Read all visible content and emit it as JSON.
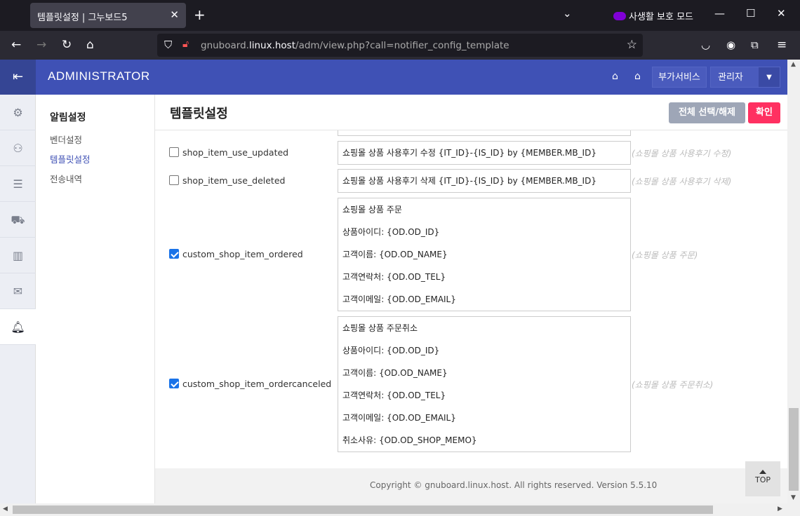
{
  "browser": {
    "tab_title": "템플릿설정 | 그누보드5",
    "private_mode": "사생활 보호 모드",
    "url_prefix": "gnuboard.",
    "url_host": "linux.host",
    "url_path": "/adm/view.php?call=notifier_config_template"
  },
  "header": {
    "brand": "ADMINISTRATOR",
    "service_btn": "부가서비스",
    "admin_btn": "관리자"
  },
  "sidebar": {
    "title": "알림설정",
    "items": [
      "벤더설정",
      "템플릿설정",
      "전송내역"
    ]
  },
  "page": {
    "title": "템플릿설정",
    "select_all": "전체 선택/해제",
    "confirm": "확인"
  },
  "rows": [
    {
      "key": "shop_item_use_updated",
      "checked": false,
      "lines": [
        "쇼핑몰 상품 사용후기 수정 {IT_ID}-{IS_ID} by {MEMBER.MB_ID}"
      ],
      "note": "(쇼핑몰 상품 사용후기 수정)"
    },
    {
      "key": "shop_item_use_deleted",
      "checked": false,
      "lines": [
        "쇼핑몰 상품 사용후기 삭제 {IT_ID}-{IS_ID} by {MEMBER.MB_ID}"
      ],
      "note": "(쇼핑몰 상품 사용후기 삭제)"
    },
    {
      "key": "custom_shop_item_ordered",
      "checked": true,
      "lines": [
        "쇼핑몰 상품 주문",
        "상품아이디: {OD.OD_ID}",
        "고객이름: {OD.OD_NAME}",
        "고객연락처: {OD.OD_TEL}",
        "고객이메일: {OD.OD_EMAIL}"
      ],
      "note": "(쇼핑몰 상품 주문)"
    },
    {
      "key": "custom_shop_item_ordercanceled",
      "checked": true,
      "lines": [
        "쇼핑몰 상품 주문취소",
        "상품아이디: {OD.OD_ID}",
        "고객이름: {OD.OD_NAME}",
        "고객연락처: {OD.OD_TEL}",
        "고객이메일: {OD.OD_EMAIL}",
        "취소사유: {OD.OD_SHOP_MEMO}"
      ],
      "note": "(쇼핑몰 상품 주문취소)"
    }
  ],
  "footer": {
    "copyright": "Copyright © gnuboard.linux.host. All rights reserved. Version 5.5.10",
    "top": "TOP"
  }
}
